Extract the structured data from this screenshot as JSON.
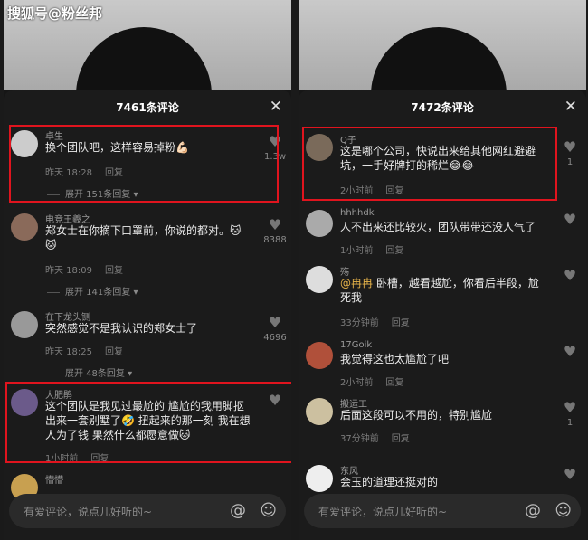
{
  "watermark": "搜狐号@粉丝邦",
  "left": {
    "title": "7461条评论",
    "comments": [
      {
        "user": "卓生",
        "text": "换个团队吧，这样容易掉粉💪🏻",
        "time": "昨天 18:28",
        "reply": "回复",
        "expand": "展开 151条回复",
        "likes": "1.3w"
      },
      {
        "user": "电竞王羲之",
        "text": "郑女士在你摘下口罩前，你说的都对。🐱🐱",
        "time": "昨天 18:09",
        "reply": "回复",
        "expand": "展开 141条回复",
        "likes": "8388"
      },
      {
        "user": "在下龙头铡",
        "text": "突然感觉不是我认识的郑女士了",
        "time": "昨天 18:25",
        "reply": "回复",
        "expand": "展开 48条回复",
        "likes": "4696"
      },
      {
        "user": "大肥鹃",
        "text": "这个团队是我见过最尬的 尴尬的我用脚抠出来一套别墅了🤣 扭起来的那一刻 我在想 人为了钱 果然什么都愿意做🐱",
        "time": "1小时前",
        "reply": "回复",
        "likes": ""
      },
      {
        "user": "懵懵",
        "text": "",
        "time": "",
        "reply": "",
        "likes": ""
      }
    ],
    "placeholder": "有爱评论，说点儿好听的~"
  },
  "right": {
    "title": "7472条评论",
    "comments": [
      {
        "user": "Q子",
        "text": "这是哪个公司，快说出来给其他网红避避坑，一手好牌打的稀烂😂😂",
        "time": "2小时前",
        "reply": "回复",
        "likes": "1"
      },
      {
        "user": "hhhhdk",
        "text": "人不出来还比较火，团队带带还没人气了",
        "time": "1小时前",
        "reply": "回复",
        "likes": ""
      },
      {
        "user": "殇",
        "mention": "@冉冉",
        "text": " 卧槽，越看越尬，你看后半段，尬死我",
        "time": "33分钟前",
        "reply": "回复",
        "likes": ""
      },
      {
        "user": "17Goik",
        "text": "我觉得这也太尴尬了吧",
        "time": "2小时前",
        "reply": "回复",
        "likes": ""
      },
      {
        "user": "搬运工",
        "text": "后面这段可以不用的，特别尴尬",
        "time": "37分钟前",
        "reply": "回复",
        "likes": "1"
      },
      {
        "user": "东风",
        "text": "会玉的道理还挺对的",
        "time": "",
        "reply": "",
        "likes": ""
      }
    ],
    "placeholder": "有爱评论，说点儿好听的~"
  },
  "icons": {
    "close": "close-icon",
    "heart": "heart-icon",
    "at": "at-icon",
    "emoji": "emoji-icon"
  },
  "colors": {
    "highlight": "#e0141e",
    "mention": "#e6b34a"
  }
}
